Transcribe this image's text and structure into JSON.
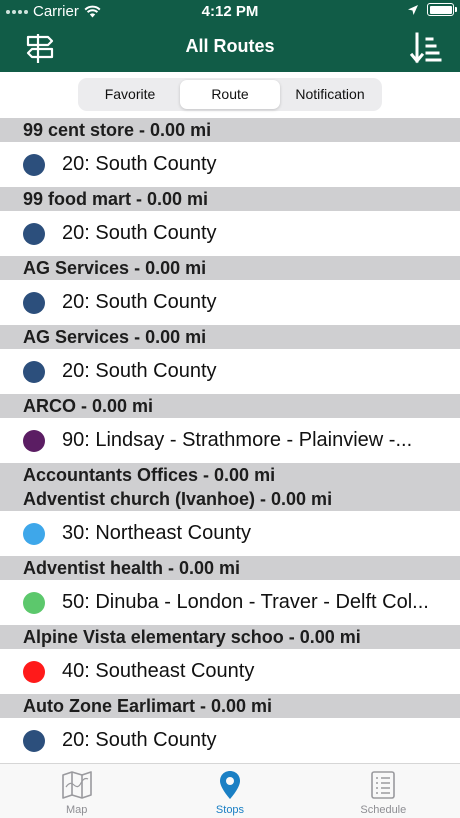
{
  "status_bar": {
    "carrier": "Carrier",
    "time": "4:12 PM"
  },
  "nav": {
    "title": "All Routes"
  },
  "segments": [
    {
      "label": "Favorite",
      "active": false
    },
    {
      "label": "Route",
      "active": true
    },
    {
      "label": "Notification",
      "active": false
    }
  ],
  "groups": [
    {
      "headers": [
        "99 cent store - 0.00 mi"
      ],
      "routes": [
        {
          "label": "20: South County",
          "color": "#2c4f7c"
        }
      ]
    },
    {
      "headers": [
        "99 food mart - 0.00 mi"
      ],
      "routes": [
        {
          "label": "20: South County",
          "color": "#2c4f7c"
        }
      ]
    },
    {
      "headers": [
        "AG Services - 0.00 mi"
      ],
      "routes": [
        {
          "label": "20: South County",
          "color": "#2c4f7c"
        }
      ]
    },
    {
      "headers": [
        "AG Services - 0.00 mi"
      ],
      "routes": [
        {
          "label": "20: South County",
          "color": "#2c4f7c"
        }
      ]
    },
    {
      "headers": [
        "ARCO - 0.00 mi"
      ],
      "routes": [
        {
          "label": "90: Lindsay - Strathmore - Plainview -...",
          "color": "#5b1d63"
        }
      ]
    },
    {
      "headers": [
        "Accountants Offices - 0.00 mi",
        "Adventist church (Ivanhoe) - 0.00 mi"
      ],
      "routes": [
        {
          "label": "30: Northeast County",
          "color": "#3ea7ea"
        }
      ]
    },
    {
      "headers": [
        "Adventist health - 0.00 mi"
      ],
      "routes": [
        {
          "label": "50: Dinuba - London - Traver - Delft Col...",
          "color": "#5cc86c"
        }
      ]
    },
    {
      "headers": [
        "Alpine Vista elementary schoo - 0.00 mi"
      ],
      "routes": [
        {
          "label": "40: Southeast County",
          "color": "#ff1a1a"
        }
      ]
    },
    {
      "headers": [
        "Auto Zone Earlimart - 0.00 mi"
      ],
      "routes": [
        {
          "label": "20: South County",
          "color": "#2c4f7c"
        }
      ]
    }
  ],
  "tabs": [
    {
      "label": "Map",
      "icon": "map-icon",
      "active": false
    },
    {
      "label": "Stops",
      "icon": "location-pin-icon",
      "active": true
    },
    {
      "label": "Schedule",
      "icon": "schedule-list-icon",
      "active": false
    }
  ],
  "colors": {
    "nav_green": "#115c47",
    "active_tab": "#1a7fc4",
    "section_header": "#cfcfd1"
  }
}
